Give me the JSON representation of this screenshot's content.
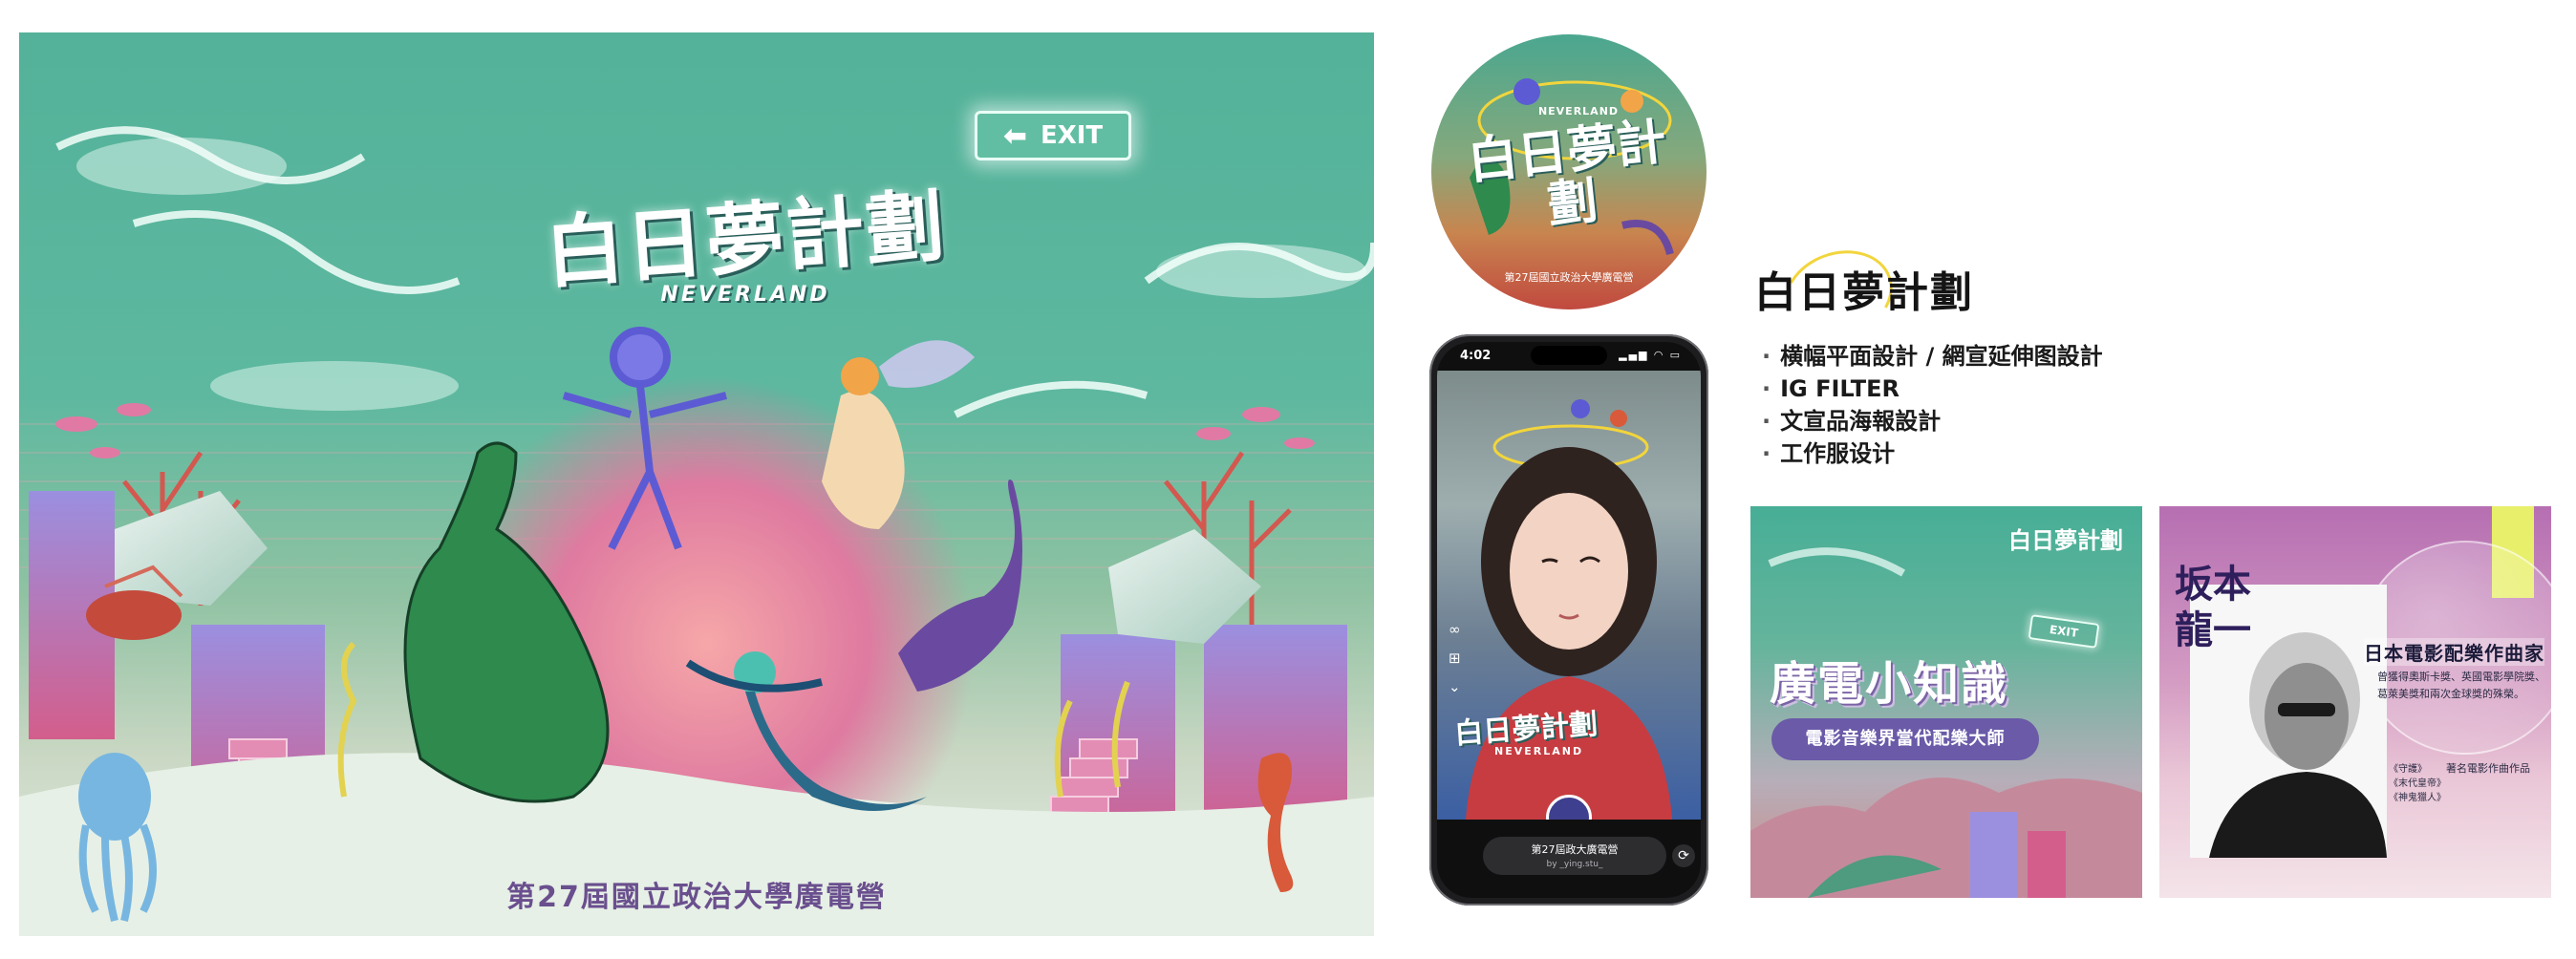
{
  "poster": {
    "exit_text": "EXIT",
    "logo_main": "白日夢計劃",
    "logo_sub": "NEVERLAND",
    "footer": "第27屆國立政治大學廣電營"
  },
  "sticker": {
    "logo_main": "白日夢計劃",
    "logo_sub": "NEVERLAND",
    "footer": "第27屆國立政治大學廣電營"
  },
  "phone": {
    "time": "4:02",
    "status_icons": "▂▄▆ ◠ ▭",
    "filter_name": "第27屆政大廣電營",
    "filter_author": "by _ying.stu_",
    "logo_main": "白日夢計劃",
    "logo_sub": "NEVERLAND"
  },
  "project": {
    "title": "白日夢計劃",
    "items": [
      "横幅平面設計 / 網宣延伸图設計",
      "IG FILTER",
      "文宣品海報設計",
      "工作服设计"
    ]
  },
  "ig_post_1": {
    "corner_logo": "白日夢計劃",
    "exit_text": "EXIT",
    "headline": "廣電小知識",
    "pill": "電影音樂界當代配樂大師"
  },
  "ig_post_2": {
    "name": "坂本龍一",
    "role": "日本電影配樂作曲家",
    "desc": "曾獲得奧斯卡獎、英國電影學院獎、葛萊美獎和兩次金球獎的殊榮。",
    "works": [
      "《守護》",
      "《末代皇帝》",
      "《神鬼獵人》"
    ],
    "tag": "著名電影作曲作品"
  },
  "colors": {
    "teal": "#54b29a",
    "purple": "#6a5aa8",
    "coral": "#c1493f",
    "yellow": "#f2d53c"
  }
}
